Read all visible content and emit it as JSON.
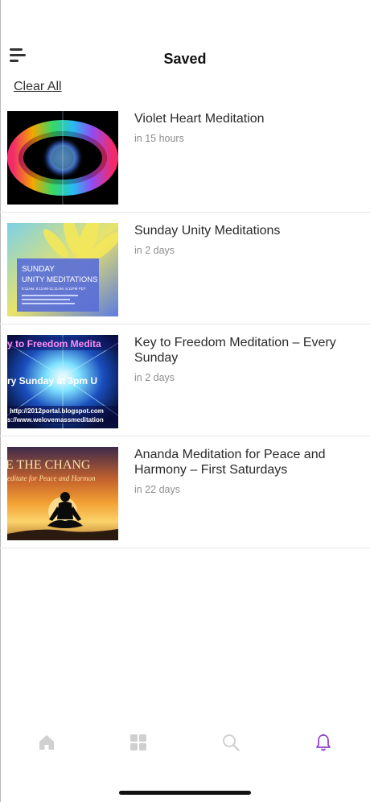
{
  "header": {
    "title": "Saved",
    "clear_all_label": "Clear All"
  },
  "items": [
    {
      "title": "Violet Heart Meditation",
      "time": "in 15 hours"
    },
    {
      "title": "Sunday Unity Meditations",
      "time": "in 2 days",
      "thumb_text": {
        "line1": "SUNDAY",
        "line2": "UNITY MEDITATIONS",
        "line3": "5:11AM, 8:11AM-11:11AM, 5:11PM PDT"
      }
    },
    {
      "title": "Key to Freedom Meditation – Every Sunday",
      "time": "in 2 days",
      "thumb_text": {
        "top": "y to Freedom Medita",
        "mid": "ry Sunday at 3pm U",
        "url1": "http://2012portal.blogspot.com",
        "url2": "s://www.welovemassmeditation"
      }
    },
    {
      "title": "Ananda Meditation for Peace and Harmony – First Saturdays",
      "time": "in 22 days",
      "thumb_text": {
        "top": "E THE CHANG",
        "sub": "editate for Peace and Harmon"
      }
    }
  ],
  "tabbar": {
    "icons": [
      "home-icon",
      "grid-icon",
      "search-icon",
      "bell-icon"
    ],
    "active_color": "#8e44c9",
    "inactive_color": "#d0d0d0"
  }
}
